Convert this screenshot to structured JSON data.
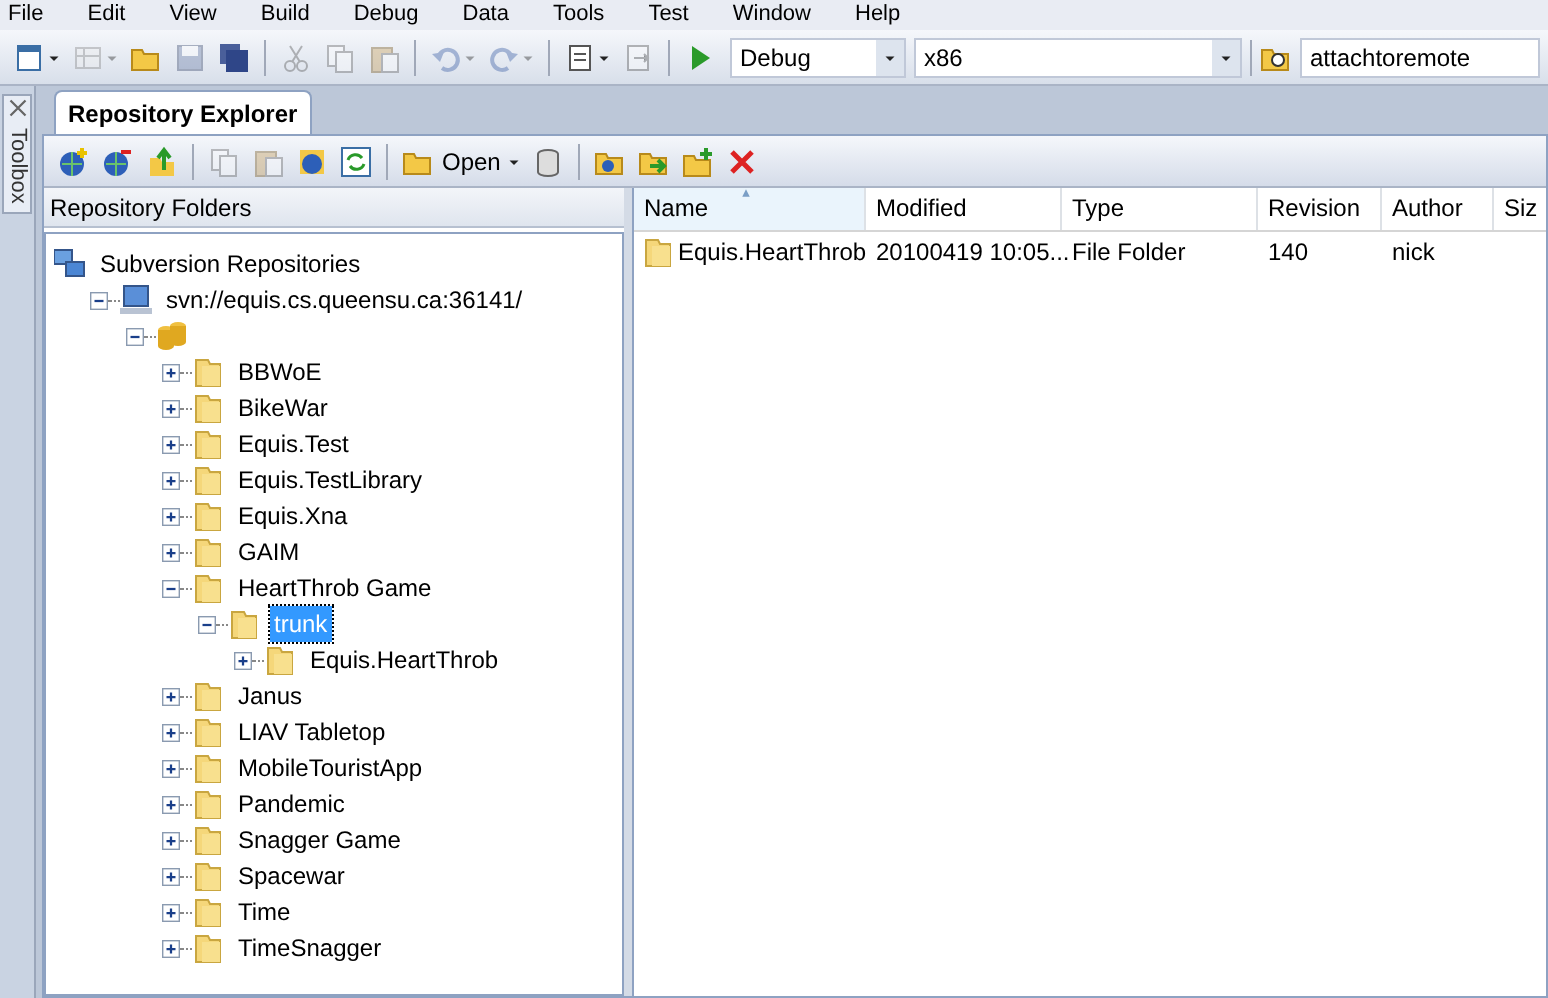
{
  "menu": [
    "File",
    "Edit",
    "View",
    "Build",
    "Debug",
    "Data",
    "Tools",
    "Test",
    "Window",
    "Help"
  ],
  "toolbar": {
    "buttons": [
      {
        "disabled": false
      },
      {
        "disabled": true
      },
      {
        "disabled": false
      },
      {
        "disabled": true
      },
      {
        "disabled": false
      },
      {
        "disabled": true
      },
      {
        "disabled": true
      },
      {
        "disabled": true
      },
      {
        "disabled": true
      },
      {
        "disabled": true
      },
      {
        "disabled": false
      },
      {
        "disabled": true
      },
      {
        "disabled": false
      }
    ],
    "configuration": "Debug",
    "platform": "x86",
    "find": "attachtoremote"
  },
  "toolbox": "Toolbox",
  "tabs": [
    {
      "label": "Repository Explorer",
      "selected": true
    }
  ],
  "repo_toolbar": {
    "buttons": [
      {
        "disabled": false
      },
      {
        "disabled": false
      },
      {
        "disabled": false
      },
      {
        "disabled": true
      },
      {
        "disabled": true
      },
      {
        "disabled": false
      },
      {
        "disabled": false
      },
      {
        "disabled": false
      },
      {
        "disabled": false
      },
      {
        "disabled": false
      },
      {
        "disabled": false
      },
      {
        "disabled": false
      },
      {
        "disabled": false
      }
    ],
    "open_label": "Open"
  },
  "folders": {
    "title": "Repository Folders",
    "tree": [
      {
        "kind": "root",
        "label": "Subversion Repositories",
        "selected": false,
        "children": [
          {
            "kind": "server",
            "label": "svn://equis.cs.queensu.ca:36141/",
            "expanded": true,
            "selected": false,
            "children": [
              {
                "kind": "database",
                "expanded": true,
                "selected": false,
                "children": [
                  {
                    "kind": "folder",
                    "label": "BBWoE",
                    "expanded": false,
                    "selected": false
                  },
                  {
                    "kind": "folder",
                    "label": "BikeWar",
                    "expanded": false,
                    "selected": false
                  },
                  {
                    "kind": "folder",
                    "label": "Equis.Test",
                    "expanded": false,
                    "selected": false
                  },
                  {
                    "kind": "folder",
                    "label": "Equis.TestLibrary",
                    "expanded": false,
                    "selected": false
                  },
                  {
                    "kind": "folder",
                    "label": "Equis.Xna",
                    "expanded": false,
                    "selected": false
                  },
                  {
                    "kind": "folder",
                    "label": "GAIM",
                    "expanded": false,
                    "selected": false
                  },
                  {
                    "kind": "folder",
                    "label": "HeartThrob Game",
                    "expanded": true,
                    "selected": false,
                    "children": [
                      {
                        "kind": "folder",
                        "label": "trunk",
                        "expanded": true,
                        "selected": true,
                        "children": [
                          {
                            "kind": "folder",
                            "label": "Equis.HeartThrob",
                            "expanded": false,
                            "selected": false
                          }
                        ]
                      }
                    ]
                  },
                  {
                    "kind": "folder",
                    "label": "Janus",
                    "expanded": false,
                    "selected": false
                  },
                  {
                    "kind": "folder",
                    "label": "LIAV Tabletop",
                    "expanded": false,
                    "selected": false
                  },
                  {
                    "kind": "folder",
                    "label": "MobileTouristApp",
                    "expanded": false,
                    "selected": false
                  },
                  {
                    "kind": "folder",
                    "label": "Pandemic",
                    "expanded": false,
                    "selected": false
                  },
                  {
                    "kind": "folder",
                    "label": "Snagger Game",
                    "expanded": false,
                    "selected": false
                  },
                  {
                    "kind": "folder",
                    "label": "Spacewar",
                    "expanded": false,
                    "selected": false
                  },
                  {
                    "kind": "folder",
                    "label": "Time",
                    "expanded": false,
                    "selected": false
                  },
                  {
                    "kind": "folder",
                    "label": "TimeSnagger",
                    "expanded": false,
                    "selected": false
                  }
                ]
              }
            ]
          }
        ]
      }
    ]
  },
  "files": {
    "columns": [
      {
        "label": "Name",
        "sorted": true
      },
      {
        "label": "Modified",
        "sorted": false
      },
      {
        "label": "Type",
        "sorted": false
      },
      {
        "label": "Revision",
        "sorted": false
      },
      {
        "label": "Author",
        "sorted": false
      },
      {
        "label": "Siz",
        "sorted": false
      }
    ],
    "rows": [
      {
        "cells": [
          "Equis.HeartThrob",
          "20100419 10:05...",
          "File Folder",
          "140",
          "nick"
        ]
      }
    ]
  }
}
